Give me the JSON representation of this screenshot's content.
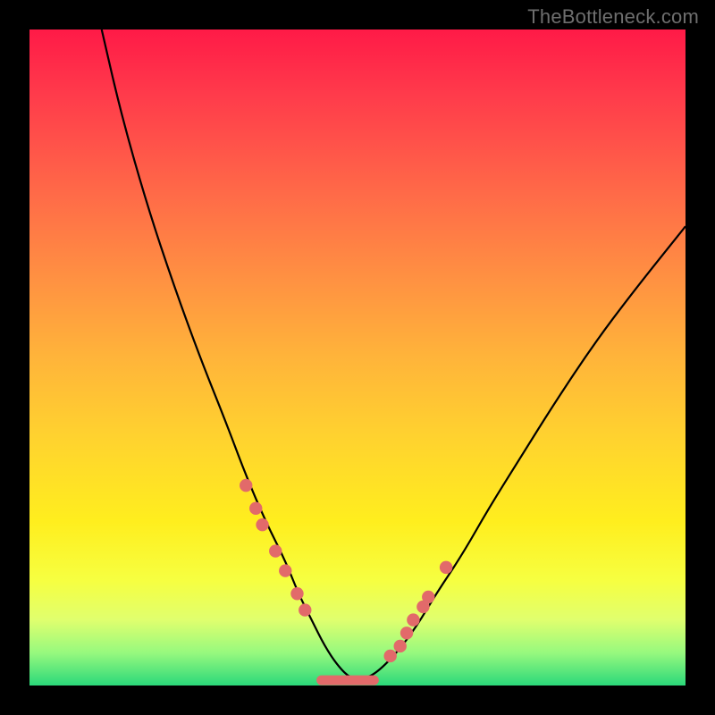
{
  "watermark": "TheBottleneck.com",
  "colors": {
    "background_frame": "#000000",
    "curve": "#000000",
    "marker": "#e26a6a",
    "gradient_stops": [
      "#ff1a47",
      "#ff6a48",
      "#ffee1e",
      "#2bd87a"
    ]
  },
  "chart_data": {
    "type": "line",
    "title": "",
    "xlabel": "",
    "ylabel": "",
    "xlim": [
      0,
      100
    ],
    "ylim": [
      0,
      100
    ],
    "grid": false,
    "legend": false,
    "notes": "V-shaped bottleneck-style curve. X and Y values are approximate percentages (0 = left/bottom, 100 = right/top) estimated from pixel positions; the source image has no axis labels.",
    "series": [
      {
        "name": "curve",
        "x": [
          11,
          14,
          18,
          22,
          26,
          30,
          33,
          36,
          39,
          41,
          43,
          45,
          47,
          49,
          51,
          53,
          56,
          59,
          62,
          66,
          70,
          75,
          80,
          86,
          92,
          100
        ],
        "y": [
          100,
          87,
          73,
          61,
          50,
          40,
          32,
          25,
          19,
          14,
          10,
          6,
          3,
          1,
          1,
          2,
          5,
          9,
          14,
          20,
          27,
          35,
          43,
          52,
          60,
          70
        ]
      }
    ],
    "markers": {
      "name": "highlighted-points",
      "color": "#e26a6a",
      "x": [
        33.0,
        34.5,
        35.5,
        37.5,
        39.0,
        40.8,
        42.0,
        55.0,
        56.5,
        57.5,
        58.5,
        60.0,
        60.8,
        63.5
      ],
      "y": [
        30.5,
        27.0,
        24.5,
        20.5,
        17.5,
        14.0,
        11.5,
        4.5,
        6.0,
        8.0,
        10.0,
        12.0,
        13.5,
        18.0
      ]
    },
    "flat_segment": {
      "name": "minimum-plateau",
      "color": "#e26a6a",
      "x_start": 44.5,
      "x_end": 52.5,
      "y": 0.8
    }
  }
}
